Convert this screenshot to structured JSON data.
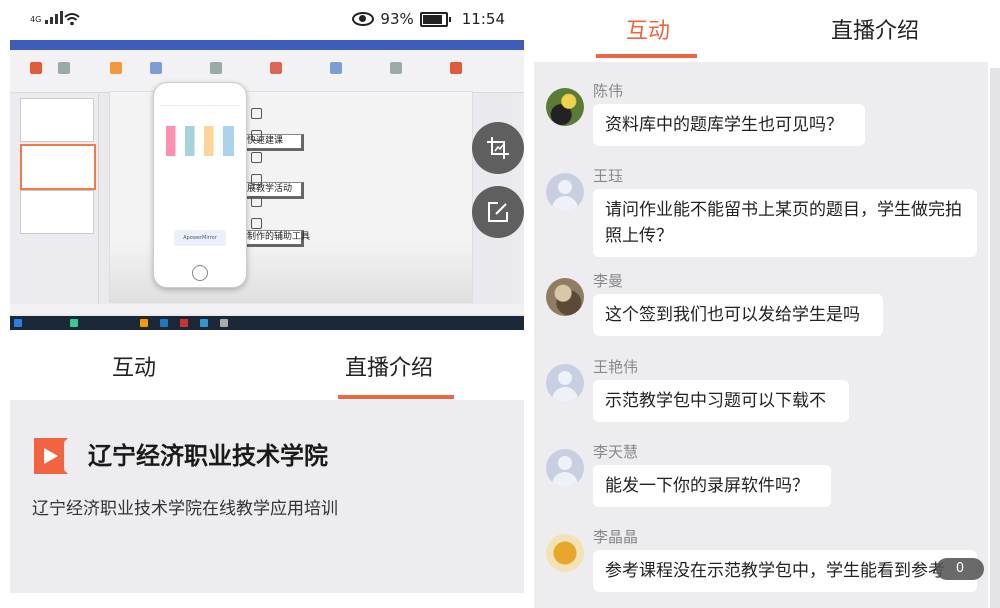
{
  "status_bar": {
    "network": "4G",
    "battery": "93%",
    "time": "11:54"
  },
  "tabs": {
    "left": [
      {
        "label": "互动"
      },
      {
        "label": "直播介绍"
      }
    ],
    "right": [
      {
        "label": "互动"
      },
      {
        "label": "直播介绍"
      }
    ]
  },
  "slide": {
    "items": [
      {
        "num": "01",
        "text": "如何快速建课"
      },
      {
        "num": "02",
        "text": "如何开展教学活动"
      },
      {
        "num": "03",
        "text": "教学资源制作的辅助工具"
      }
    ],
    "phone_label": "ApowerMirror"
  },
  "intro": {
    "school_name": "辽宁经济职业技术学院",
    "description": "辽宁经济职业技术学院在线教学应用培训"
  },
  "chat": {
    "messages": [
      {
        "user": "陈伟",
        "text": "资料库中的题库学生也可见吗？"
      },
      {
        "user": "王珏",
        "text": "请问作业能不能留书上某页的题目，学生做完拍照上传？"
      },
      {
        "user": "李曼",
        "text": "这个签到我们也可以发给学生是吗"
      },
      {
        "user": "王艳伟",
        "text": "示范教学包中习题可以下载不"
      },
      {
        "user": "李天慧",
        "text": "能发一下你的录屏软件吗？"
      },
      {
        "user": "李晶晶",
        "text": "参考课程没在示范教学包中，学生能看到参考"
      }
    ],
    "unread_count": "0"
  },
  "colors": {
    "accent": "#f1643f",
    "desktop_title": "#3d5db8"
  }
}
